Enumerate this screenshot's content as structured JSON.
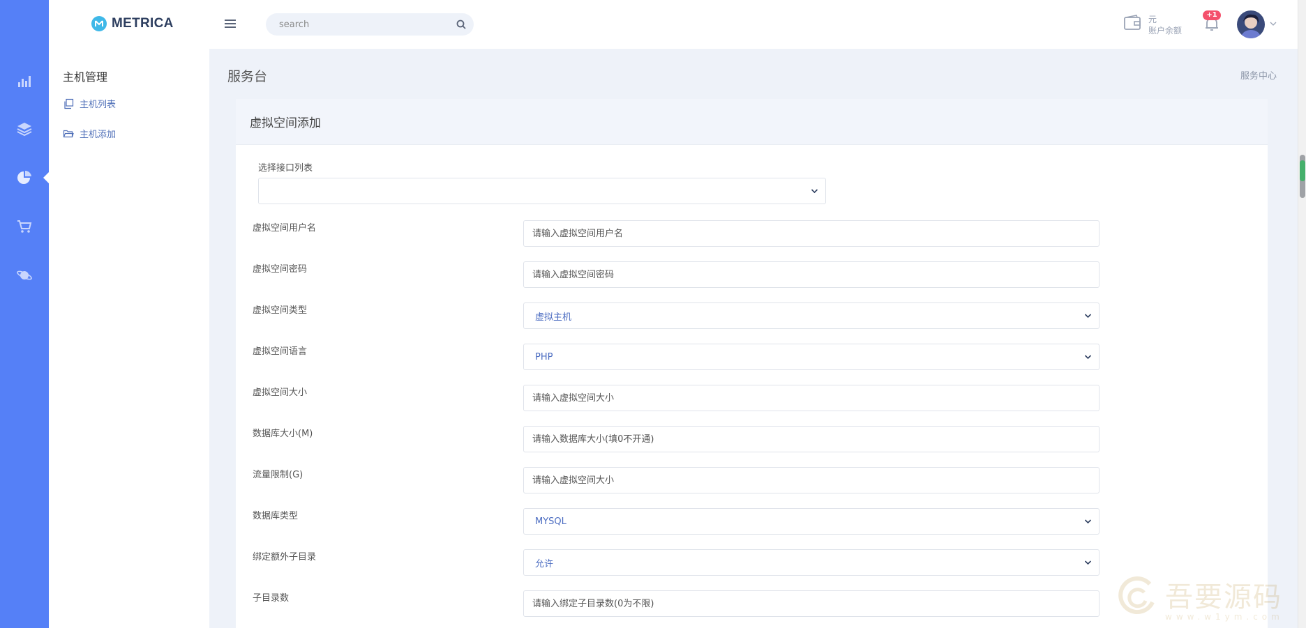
{
  "header": {
    "brand": "METRICA",
    "search_placeholder": "search",
    "wallet_currency": "元",
    "wallet_label": "账户余额",
    "notification_badge": "+1"
  },
  "rail": {
    "icons": [
      "bar-chart-icon",
      "layers-icon",
      "pie-chart-icon",
      "cart-icon",
      "planet-icon"
    ],
    "active_index": 2
  },
  "subnav": {
    "title": "主机管理",
    "items": [
      {
        "label": "主机列表",
        "icon": "copy-icon"
      },
      {
        "label": "主机添加",
        "icon": "folder-open-icon"
      }
    ]
  },
  "page": {
    "title": "服务台",
    "breadcrumb": "服务中心",
    "card_title": "虚拟空间添加",
    "api_select_label": "选择接口列表",
    "api_select_value": ""
  },
  "form": {
    "username": {
      "label": "虚拟空间用户名",
      "placeholder": "请输入虚拟空间用户名"
    },
    "password": {
      "label": "虚拟空间密码",
      "placeholder": "请输入虚拟空间密码"
    },
    "space_type": {
      "label": "虚拟空间类型",
      "value": "虚拟主机"
    },
    "language": {
      "label": "虚拟空间语言",
      "value": "PHP"
    },
    "space_size": {
      "label": "虚拟空间大小",
      "placeholder": "请输入虚拟空间大小"
    },
    "db_size": {
      "label": "数据库大小(M)",
      "placeholder": "请输入数据库大小(填0不开通)"
    },
    "traffic": {
      "label": "流量限制(G)",
      "placeholder": "请输入虚拟空间大小"
    },
    "db_type": {
      "label": "数据库类型",
      "value": "MYSQL"
    },
    "bind_subdir": {
      "label": "绑定额外子目录",
      "value": "允许"
    },
    "subdir_count": {
      "label": "子目录数",
      "placeholder": "请输入绑定子目录数(0为不限)"
    }
  },
  "watermark": {
    "text": "吾要源码",
    "url": "www.w1ym.com"
  },
  "colors": {
    "rail": "#5580f7",
    "accent_link": "#4f6fb8",
    "badge": "#f4516c"
  }
}
